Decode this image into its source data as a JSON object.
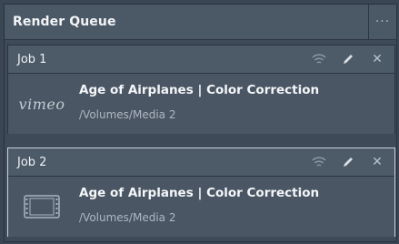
{
  "panel": {
    "title": "Render Queue",
    "menu_glyph": "···"
  },
  "jobs": [
    {
      "label": "Job 1",
      "title": "Age of Airplanes | Color Correction",
      "path": "/Volumes/Media 2",
      "thumbnail": "vimeo",
      "thumbnail_text": "vimeo",
      "selected": false
    },
    {
      "label": "Job 2",
      "title": "Age of Airplanes | Color Correction",
      "path": "/Volumes/Media 2",
      "thumbnail": "film-icon",
      "selected": true
    }
  ],
  "icons": {
    "broadcast": "wifi-icon",
    "edit": "pencil-icon",
    "remove": "close-icon",
    "close_glyph": "✕"
  },
  "colors": {
    "background": "#3a4654",
    "header": "#4b5866",
    "selected_border": "#c9d2da"
  }
}
